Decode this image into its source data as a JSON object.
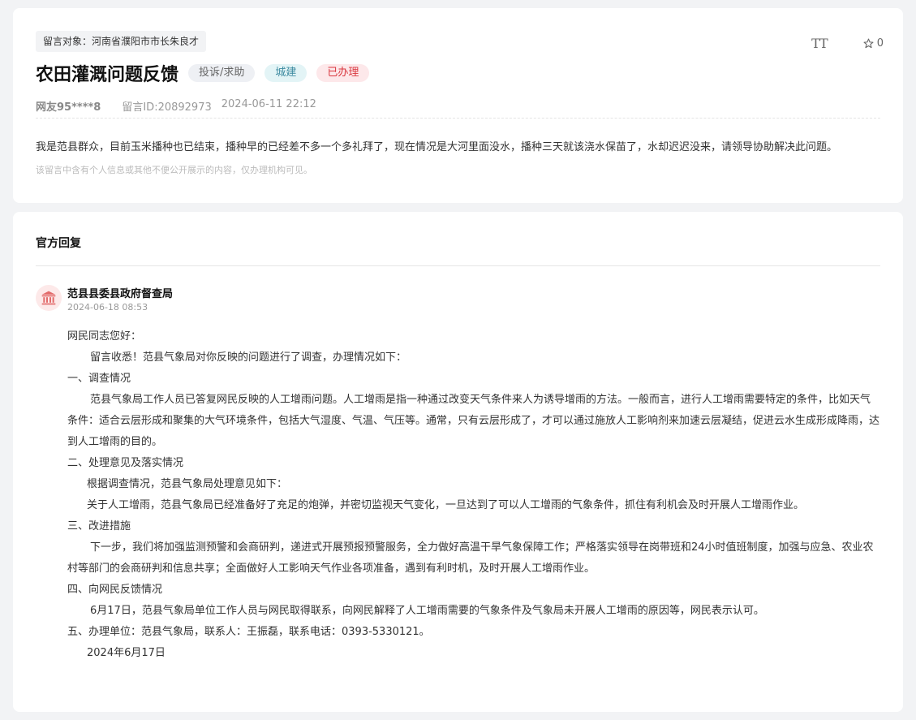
{
  "message": {
    "target": "留言对象：河南省濮阳市市长朱良才",
    "title": "农田灌溉问题反馈",
    "tags": [
      "投诉/求助",
      "城建",
      "已办理"
    ],
    "user": "网友95****8",
    "message_id": "留言ID:20892973",
    "datetime": "2024-06-11 22:12",
    "content": "我是范县群众，目前玉米播种也已结束，播种早的已经差不多一个多礼拜了，现在情况是大河里面没水，播种三天就该浇水保苗了，水却迟迟没来，请领导协助解决此问题。",
    "privacy_note": "该留言中含有个人信息或其他不便公开展示的内容，仅办理机构可见。",
    "favorite_count": "0",
    "font_size_icon": "TT"
  },
  "reply": {
    "heading": "官方回复",
    "org_name": "范县县委县政府督查局",
    "org_time": "2024-06-18 08:53",
    "paragraphs": [
      "网民同志您好：",
      "留言收悉！范县气象局对你反映的问题进行了调查，办理情况如下：",
      "一、调查情况",
      "范县气象局工作人员已答复网民反映的人工增雨问题。人工增雨是指一种通过改变天气条件来人为诱导增雨的方法。一般而言，进行人工增雨需要特定的条件，比如天气条件：适合云层形成和聚集的大气环境条件，包括大气湿度、气温、气压等。通常，只有云层形成了，才可以通过施放人工影响剂来加速云层凝结，促进云水生成形成降雨，达到人工增雨的目的。",
      "二、处理意见及落实情况",
      "根据调查情况，范县气象局处理意见如下：",
      "关于人工增雨，范县气象局已经准备好了充足的炮弹，并密切监视天气变化，一旦达到了可以人工增雨的气象条件，抓住有利机会及时开展人工增雨作业。",
      "三、改进措施",
      "下一步，我们将加强监测预警和会商研判，递进式开展预报预警服务，全力做好高温干旱气象保障工作；严格落实领导在岗带班和24小时值班制度，加强与应急、农业农村等部门的会商研判和信息共享；全面做好人工影响天气作业各项准备，遇到有利时机，及时开展人工增雨作业。",
      "四、向网民反馈情况",
      "6月17日，范县气象局单位工作人员与网民取得联系，向网民解释了人工增雨需要的气象条件及气象局未开展人工增雨的原因等，网民表示认可。",
      "五、办理单位：范县气象局，联系人：王振磊，联系电话：0393-5330121。",
      "2024年6月17日"
    ]
  },
  "colors": {
    "tag_status_red": "#d9363e",
    "tag_category_cyan": "#3d8aa0",
    "avatar_bg": "#fde9e9",
    "avatar_icon": "#e26b6b"
  },
  "icons": {
    "font_size": "font-size-icon",
    "favorite": "star-icon",
    "org": "government-building-icon"
  }
}
